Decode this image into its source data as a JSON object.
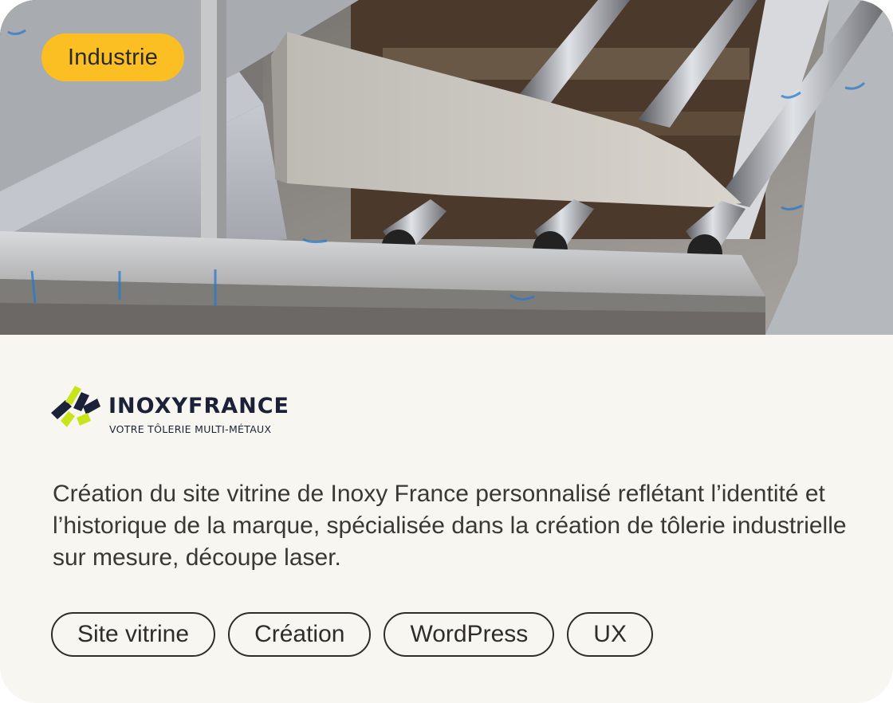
{
  "card": {
    "category": "Industrie",
    "image_alt": "Structure en inox soudée avec tubes",
    "logo": {
      "name": "INOXYFRANCE",
      "tagline": "VOTRE TÔLERIE MULTI-MÉTAUX",
      "colors": {
        "navy": "#1b2238",
        "lime": "#c8e51b"
      }
    },
    "description": "Création du site vitrine de Inoxy France personnalisé reflétant l’identité et l’historique de la marque, spécialisée  dans la  création de tôlerie industrielle sur mesure, découpe laser.",
    "tags": [
      "Site  vitrine",
      "Création",
      "WordPress",
      "UX"
    ]
  },
  "colors": {
    "background": "#f8f6f1",
    "badge": "#fbbf23",
    "text": "#3a3835"
  }
}
